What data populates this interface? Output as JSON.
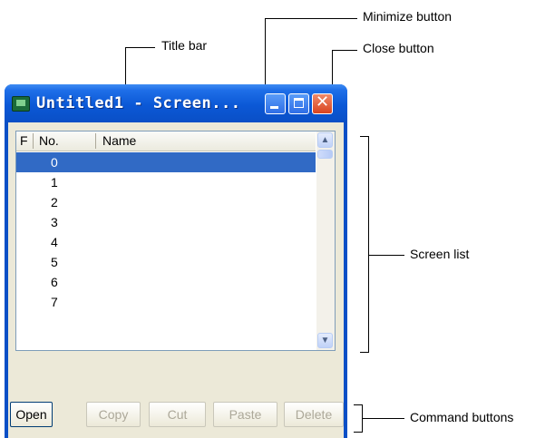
{
  "annotations": {
    "title_bar": "Title bar",
    "minimize_button": "Minimize button",
    "close_button": "Close button",
    "screen_list": "Screen list",
    "command_buttons": "Command buttons"
  },
  "window": {
    "title": "Untitled1 - Screen...",
    "close_glyph": "✕"
  },
  "list": {
    "columns": {
      "f": "F",
      "no": "No.",
      "name": "Name"
    },
    "rows": [
      "0",
      "1",
      "2",
      "3",
      "4",
      "5",
      "6",
      "7"
    ],
    "selected_index": 0,
    "scroll_up_glyph": "▲",
    "scroll_down_glyph": "▼"
  },
  "buttons": {
    "open": "Open",
    "copy": "Copy",
    "cut": "Cut",
    "paste": "Paste",
    "delete": "Delete"
  },
  "colors": {
    "titlebar": "#0a5ad8",
    "selection": "#316ac5",
    "close": "#d9441f"
  }
}
